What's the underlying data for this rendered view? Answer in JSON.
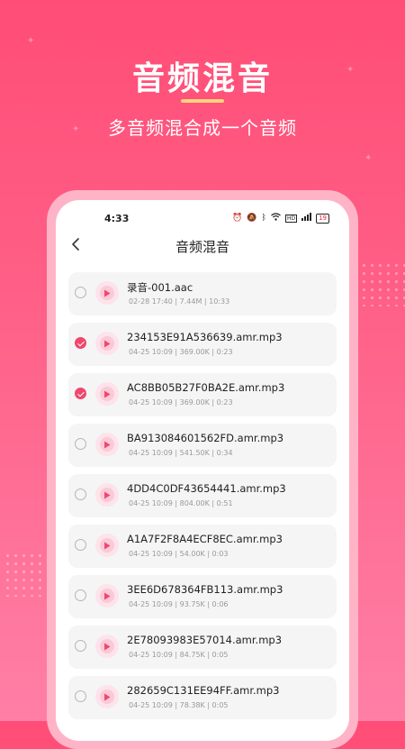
{
  "promo": {
    "headline": "音频混音",
    "subtitle": "多音频混合成一个音频"
  },
  "status_bar": {
    "time": "4:33",
    "battery": "19"
  },
  "nav": {
    "title": "音频混音"
  },
  "colors": {
    "accent": "#f0476e",
    "background_top": "#ff4d77",
    "background_bottom": "#ff7fa6",
    "underline": "#ffd27a"
  },
  "files": [
    {
      "name": "录音-001.aac",
      "meta": "02-28 17:40 | 7.44M | 10:33",
      "checked": false
    },
    {
      "name": "234153E91A536639.amr.mp3",
      "meta": "04-25 10:09 | 369.00K | 0:23",
      "checked": true
    },
    {
      "name": "AC8BB05B27F0BA2E.amr.mp3",
      "meta": "04-25 10:09 | 369.00K | 0:23",
      "checked": true
    },
    {
      "name": "BA913084601562FD.amr.mp3",
      "meta": "04-25 10:09 | 541.50K | 0:34",
      "checked": false
    },
    {
      "name": "4DD4C0DF43654441.amr.mp3",
      "meta": "04-25 10:09 | 804.00K | 0:51",
      "checked": false
    },
    {
      "name": "A1A7F2F8A4ECF8EC.amr.mp3",
      "meta": "04-25 10:09 | 54.00K | 0:03",
      "checked": false
    },
    {
      "name": "3EE6D678364FB113.amr.mp3",
      "meta": "04-25 10:09 | 93.75K | 0:06",
      "checked": false
    },
    {
      "name": "2E78093983E57014.amr.mp3",
      "meta": "04-25 10:09 | 84.75K | 0:05",
      "checked": false
    },
    {
      "name": "282659C131EE94FF.amr.mp3",
      "meta": "04-25 10:09 | 78.38K | 0:05",
      "checked": false
    }
  ]
}
